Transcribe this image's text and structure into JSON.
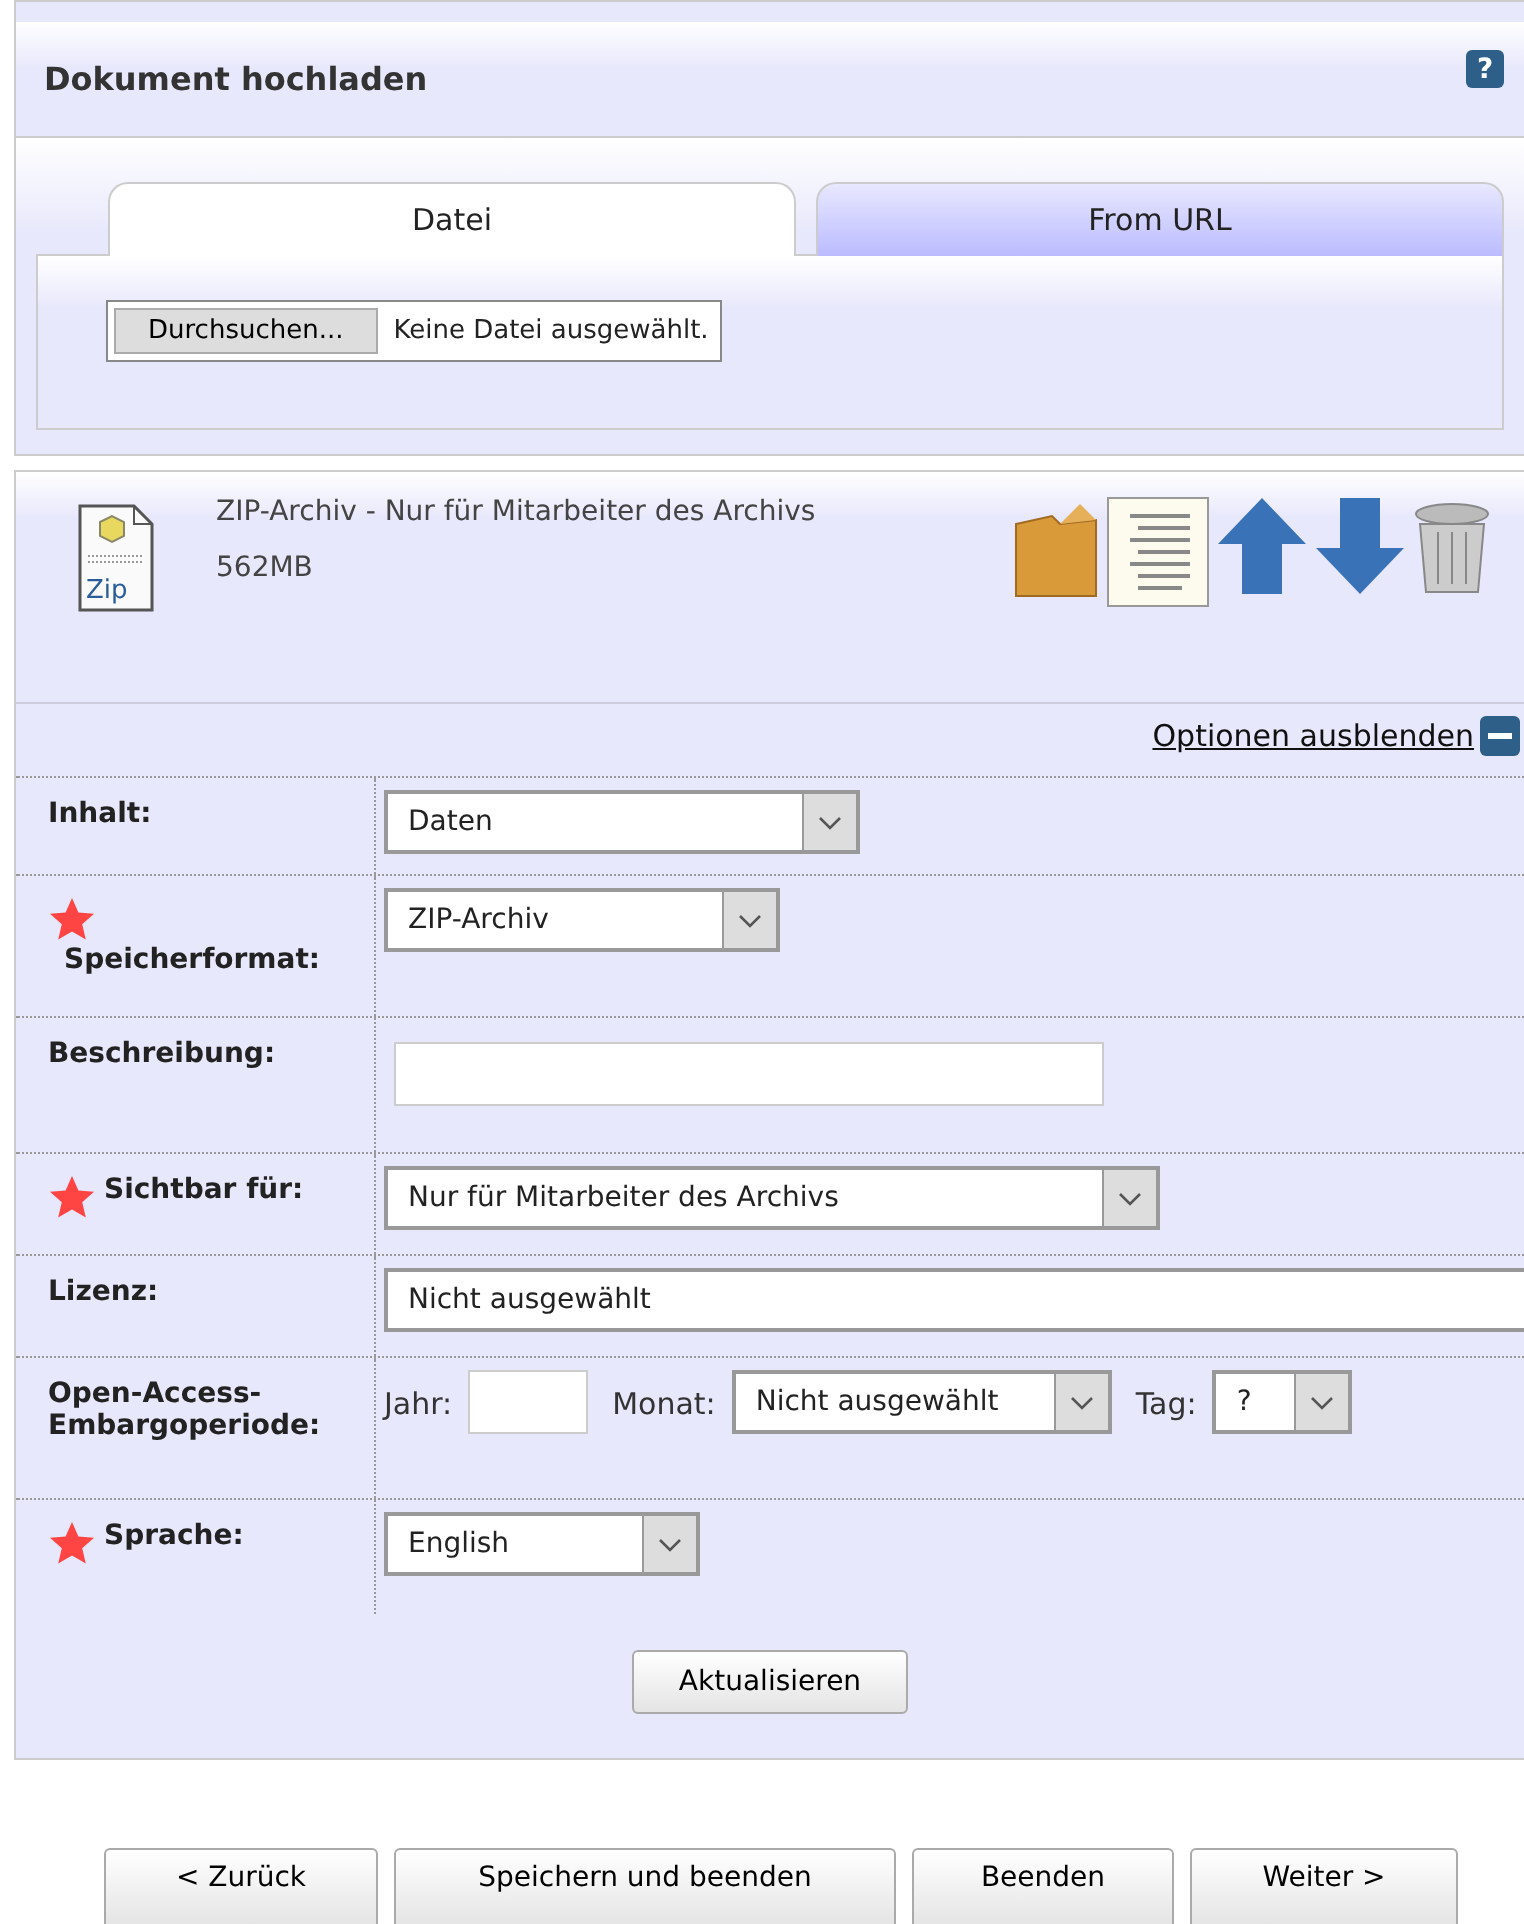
{
  "header": {
    "title": "Dokument hochladen",
    "help_icon": "?"
  },
  "tabs": [
    {
      "label": "Datei",
      "selected": true
    },
    {
      "label": "From URL",
      "selected": false
    }
  ],
  "file_picker": {
    "button": "Durchsuchen...",
    "status": "Keine Datei ausgewählt."
  },
  "file": {
    "icon_label": "Zip",
    "title": "ZIP-Archiv - Nur für Mitarbeiter des Archivs",
    "size": "562MB"
  },
  "options_toggle": {
    "label": "Optionen ausblenden",
    "expanded": true
  },
  "fields": [
    {
      "kind": "select",
      "label": "Inhalt:",
      "required": false,
      "value": "Daten"
    },
    {
      "kind": "select",
      "label": "Speicherformat:",
      "required": true,
      "value": "ZIP-Archiv"
    },
    {
      "kind": "text",
      "label": "Beschreibung:",
      "required": false
    },
    {
      "kind": "select",
      "label": "Sichtbar für:",
      "required": true,
      "value": "Nur für Mitarbeiter des Archivs"
    },
    {
      "kind": "wide",
      "label": "Lizenz:",
      "required": false,
      "value": "Nicht ausgewählt"
    },
    {
      "kind": "embargo",
      "label": "Open-Access-Embargoperiode:",
      "required": false,
      "year_label": "Jahr:",
      "month_label": "Monat:",
      "month": "Nicht ausgewählt",
      "day_label": "Tag:",
      "day": "?"
    },
    {
      "kind": "select",
      "label": "Sprache:",
      "required": true,
      "value": "English"
    }
  ],
  "update_button": "Aktualisieren",
  "nav_buttons": [
    "< Zurück",
    "Speichern und beenden",
    "Beenden",
    "Weiter >"
  ]
}
